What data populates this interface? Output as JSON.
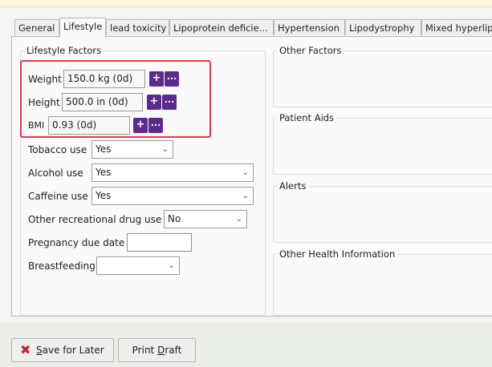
{
  "tabs": [
    "General",
    "Lifestyle",
    "lead toxicity",
    "Lipoprotein deficie...",
    "Hypertension",
    "Lipodystrophy",
    "Mixed hyperlip"
  ],
  "lifestyle_factors": {
    "title": "Lifestyle Factors",
    "weight": {
      "label": "Weight",
      "value": "150.0 kg (0d)"
    },
    "height": {
      "label": "Height",
      "value": "500.0 in (0d)"
    },
    "bmi": {
      "label": "BMI",
      "value": "0.93 (0d)"
    },
    "add_symbol": "+",
    "more_symbol": "...",
    "tobacco": {
      "label": "Tobacco use",
      "value": "Yes"
    },
    "alcohol": {
      "label": "Alcohol use",
      "value": "Yes"
    },
    "caffeine": {
      "label": "Caffeine use",
      "value": "Yes"
    },
    "recreational": {
      "label": "Other recreational drug use",
      "value": "No"
    },
    "pregnancy": {
      "label": "Pregnancy due date",
      "value": ""
    },
    "breastfeeding": {
      "label": "Breastfeeding",
      "value": ""
    }
  },
  "right_groups": {
    "other_factors": "Other Factors",
    "patient_aids": "Patient Aids",
    "alerts": "Alerts",
    "other_health": "Other Health Information"
  },
  "footer": {
    "save_prefix": "",
    "save_mnemonic": "S",
    "save_rest": "ave for Later",
    "print_prefix": "Print ",
    "print_mnemonic": "D",
    "print_rest": "raft"
  },
  "icons": {
    "dropdown_chevron": "chevron-down-icon",
    "save_icon": "red-x-icon"
  },
  "colors": {
    "action_button": "#5b2c8c",
    "highlight_box": "#e43a4a",
    "footer_bg": "#e9efe6"
  }
}
